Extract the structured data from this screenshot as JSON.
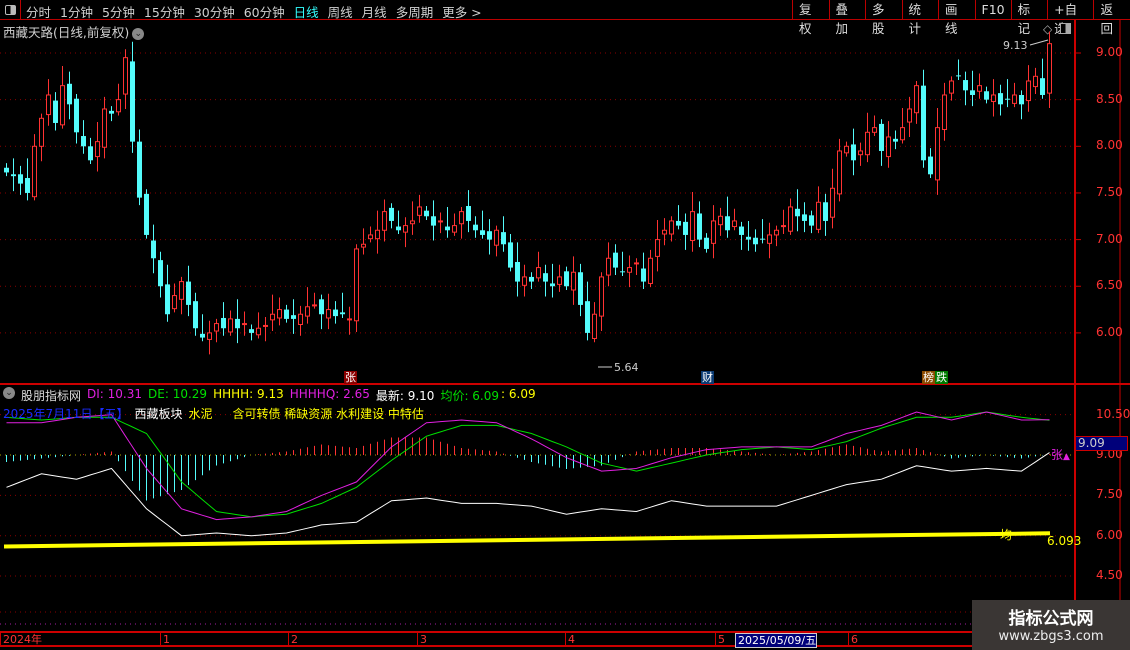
{
  "toolbar": {
    "tabs": [
      "分时",
      "1分钟",
      "5分钟",
      "15分钟",
      "30分钟",
      "60分钟",
      "日线",
      "周线",
      "月线",
      "多周期",
      "更多 >"
    ],
    "active_tab": "日线",
    "right_buttons": [
      "复权",
      "叠加",
      "多股",
      "统计",
      "画线",
      "F10",
      "标记",
      "+自选",
      "返回"
    ]
  },
  "chart_title": "西藏天路(日线,前复权)",
  "colors": {
    "up": "#ff3232",
    "down": "#54fcfc",
    "grid": "#8a0000",
    "axis": "#ff3333",
    "di": "#e020e0",
    "de": "#00e000",
    "white": "#ffffff",
    "avg": "#ffff00"
  },
  "main_axis": {
    "labels": [
      "9.00",
      "8.50",
      "8.00",
      "7.50",
      "7.00",
      "6.50",
      "6.00"
    ],
    "values": [
      9,
      8.5,
      8,
      7.5,
      7,
      6.5,
      6
    ]
  },
  "annotations": {
    "high_label": "9.13",
    "low_label": "5.64",
    "marker_zhang": "张",
    "marker_cai": "财",
    "marker_bang": "榜",
    "marker_die": "跌"
  },
  "closes": [
    7.72,
    7.68,
    7.6,
    7.5,
    8.0,
    8.3,
    8.55,
    8.25,
    8.65,
    8.45,
    8.15,
    8.0,
    7.85,
    8.05,
    8.4,
    8.35,
    8.5,
    8.95,
    8.05,
    7.45,
    7.05,
    6.8,
    6.5,
    6.2,
    6.4,
    6.55,
    6.3,
    6.05,
    5.95,
    6.0,
    6.1,
    6.05,
    6.15,
    6.05,
    6.1,
    6.0,
    6.05,
    6.08,
    6.2,
    6.25,
    6.15,
    6.15,
    6.2,
    6.28,
    6.3,
    6.2,
    6.25,
    6.18,
    6.2,
    6.15,
    6.9,
    6.95,
    7.05,
    7.1,
    7.3,
    7.2,
    7.1,
    7.15,
    7.2,
    7.35,
    7.25,
    7.15,
    7.2,
    7.1,
    7.15,
    7.3,
    7.2,
    7.1,
    7.05,
    7.0,
    7.1,
    6.95,
    6.7,
    6.55,
    6.6,
    6.55,
    6.7,
    6.55,
    6.5,
    6.6,
    6.5,
    6.65,
    6.3,
    6.0,
    6.2,
    6.6,
    6.8,
    6.7,
    6.65,
    6.7,
    6.75,
    6.55,
    6.8,
    7.0,
    7.1,
    7.2,
    7.15,
    7.05,
    7.3,
    7.0,
    6.9,
    7.2,
    7.25,
    7.1,
    7.2,
    7.05,
    7.0,
    6.95,
    7.0,
    7.05,
    7.1,
    7.15,
    7.35,
    7.25,
    7.2,
    7.15,
    7.4,
    7.2,
    7.55,
    7.95,
    8.0,
    7.85,
    7.95,
    8.15,
    8.2,
    7.95,
    8.1,
    8.05,
    8.2,
    8.4,
    8.65,
    7.85,
    7.7,
    8.2,
    8.55,
    8.7,
    8.75,
    8.6,
    8.55,
    8.65,
    8.5,
    8.55,
    8.45,
    8.5,
    8.55,
    8.45,
    8.7,
    8.75,
    8.55,
    9.1
  ],
  "indicator": {
    "name": "股朋指标网",
    "di_label": "DI: 10.31",
    "de_label": "DE: 10.29",
    "hhhh_label": "HHHH: 9.13",
    "hhhhq_label": "HHHHQ: 2.65",
    "latest_label": "最新: 9.10",
    "avg_label": "均价: 6.09",
    "avg2_label": ": 6.09",
    "date_label": "2025年7月11日【五】",
    "sector_label": "西藏板块",
    "industry": "水泥",
    "concepts": "含可转债 稀缺资源 水利建设 中特估",
    "axis_labels": [
      "10.50",
      "9.00",
      "7.50",
      "6.00",
      "4.50"
    ],
    "axis_values": [
      10.5,
      9,
      7.5,
      6,
      4.5
    ],
    "current_value": "9.09",
    "rise_label": "张",
    "avg_mark": "均",
    "avg_value": "6.093",
    "key_index": [
      0,
      5,
      10,
      15,
      20,
      25,
      30,
      35,
      40,
      45,
      50,
      55,
      60,
      65,
      70,
      75,
      80,
      85,
      90,
      95,
      100,
      105,
      110,
      115,
      120,
      125,
      130,
      135,
      140,
      145,
      149
    ],
    "white": [
      7.8,
      8.3,
      8.1,
      8.5,
      7.0,
      6.0,
      6.1,
      6.0,
      6.1,
      6.4,
      6.5,
      7.3,
      7.4,
      7.2,
      7.2,
      7.1,
      6.8,
      7.0,
      6.9,
      7.3,
      7.1,
      7.1,
      7.1,
      7.5,
      7.9,
      8.1,
      8.6,
      8.4,
      8.5,
      8.4,
      9.09
    ],
    "purple": [
      10.2,
      10.2,
      10.4,
      10.5,
      8.5,
      7.0,
      6.6,
      6.7,
      6.9,
      7.5,
      8.0,
      9.3,
      10.2,
      10.3,
      10.2,
      9.6,
      8.9,
      8.4,
      8.5,
      8.9,
      9.2,
      9.3,
      9.3,
      9.3,
      9.8,
      10.1,
      10.6,
      10.3,
      10.6,
      10.3,
      10.31
    ],
    "green": [
      10.4,
      10.3,
      10.4,
      10.4,
      9.8,
      8.0,
      6.9,
      6.7,
      6.8,
      7.2,
      7.8,
      8.8,
      9.7,
      10.1,
      10.1,
      9.8,
      9.3,
      8.7,
      8.4,
      8.7,
      9.0,
      9.2,
      9.3,
      9.2,
      9.5,
      10.0,
      10.4,
      10.4,
      10.6,
      10.4,
      10.29
    ],
    "avg_line": [
      5.6,
      6.09
    ]
  },
  "date_axis": {
    "labels": [
      "2024年",
      "1",
      "2",
      "3",
      "4",
      "5",
      "2025/05/09/五",
      "6"
    ]
  },
  "watermark": {
    "title": "指标公式网",
    "url": "www.zbgs3.com"
  }
}
